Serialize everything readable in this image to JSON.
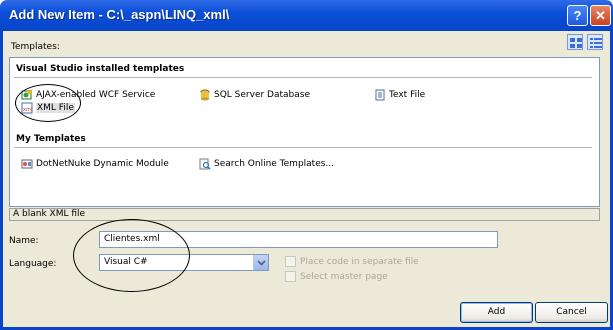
{
  "window": {
    "title": "Add New Item - C:\\_aspn\\LINQ_xml\\",
    "help_glyph": "?",
    "close_glyph": "✕"
  },
  "templates": {
    "label": "Templates:",
    "installed_header": "Visual Studio installed templates",
    "installed": [
      {
        "label": "AJAX-enabled WCF Service",
        "icon": "wcf-service-icon"
      },
      {
        "label": "SQL Server Database",
        "icon": "database-icon"
      },
      {
        "label": "Text File",
        "icon": "text-file-icon"
      },
      {
        "label": "XML File",
        "icon": "xml-file-icon",
        "selected": true
      }
    ],
    "my_header": "My Templates",
    "mine": [
      {
        "label": "DotNetNuke Dynamic Module",
        "icon": "module-icon"
      },
      {
        "label": "Search Online Templates...",
        "icon": "search-templates-icon"
      }
    ]
  },
  "description": "A blank XML file",
  "form": {
    "name_label": "Name:",
    "name_value": "Clientes.xml",
    "language_label": "Language:",
    "language_value": "Visual C#",
    "place_code_label": "Place code in separate file",
    "master_page_label": "Select master page"
  },
  "buttons": {
    "add": "Add",
    "cancel": "Cancel"
  }
}
